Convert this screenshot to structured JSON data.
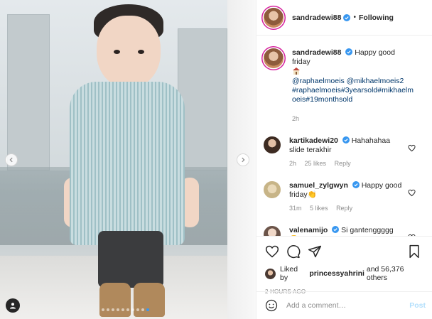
{
  "photo": {
    "carousel_dots": 10,
    "active_dot": 9
  },
  "header": {
    "username": "sandradewi88",
    "separator": "•",
    "follow_status": "Following"
  },
  "caption": {
    "username": "sandradewi88",
    "text": "Happy good friday",
    "mentions": "@raphaelmoeis @mikhaelmoeis2",
    "hashtags_line1": "#raphaelmoeis#3yearsold#mikhaelm",
    "hashtags_line2": "oeis#19monthsold",
    "time": "2h"
  },
  "comments": [
    {
      "username": "kartikadewi20",
      "text": "Hahahahaa slide terakhir",
      "time": "2h",
      "likes": "25 likes",
      "reply": "Reply"
    },
    {
      "username": "samuel_zylgwyn",
      "text": "Happy good friday👏",
      "time": "31m",
      "likes": "5 likes",
      "reply": "Reply"
    },
    {
      "username": "valenamijo",
      "text": "Si gantenggggg 😍",
      "time": "",
      "likes": "",
      "reply": ""
    }
  ],
  "likes_line": {
    "prefix": "Liked by",
    "user": "princessyahrini",
    "suffix": "and 56,376 others"
  },
  "timestamp": "2 HOURS AGO",
  "comment_box": {
    "placeholder": "Add a comment…",
    "post_label": "Post"
  },
  "colors": {
    "verified": "#3897f0",
    "link": "#00376b",
    "post_disabled": "#b2dffc"
  },
  "icons": [
    "verified-badge",
    "heart",
    "comment",
    "share",
    "bookmark",
    "emoji",
    "chevron-left",
    "chevron-right",
    "user-tag"
  ]
}
